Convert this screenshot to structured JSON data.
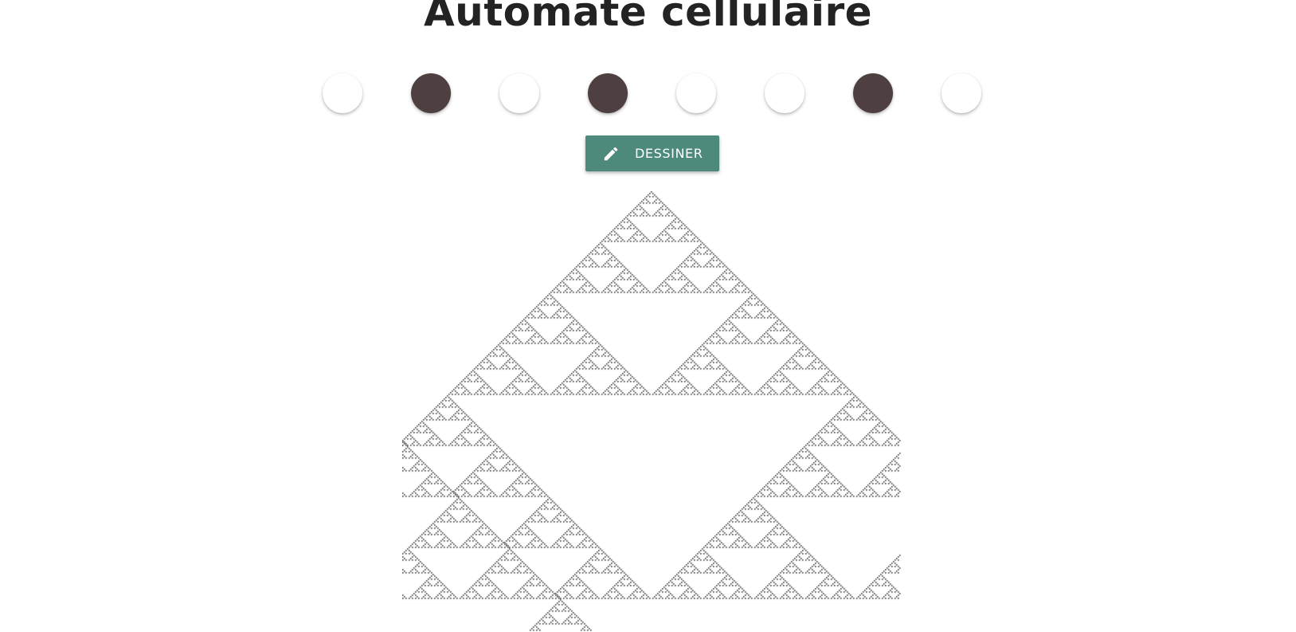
{
  "page": {
    "title": "Automate cellulaire"
  },
  "rules": {
    "states": [
      false,
      true,
      false,
      true,
      false,
      false,
      true,
      false
    ],
    "on_color": "#4e4040",
    "off_color": "#ffffff"
  },
  "toolbar": {
    "draw_label": "DESSINER",
    "draw_icon": "pencil-icon",
    "button_color": "#4e8a7c"
  },
  "automaton": {
    "cell_color": "#222222",
    "background_color": "#ffffff"
  }
}
